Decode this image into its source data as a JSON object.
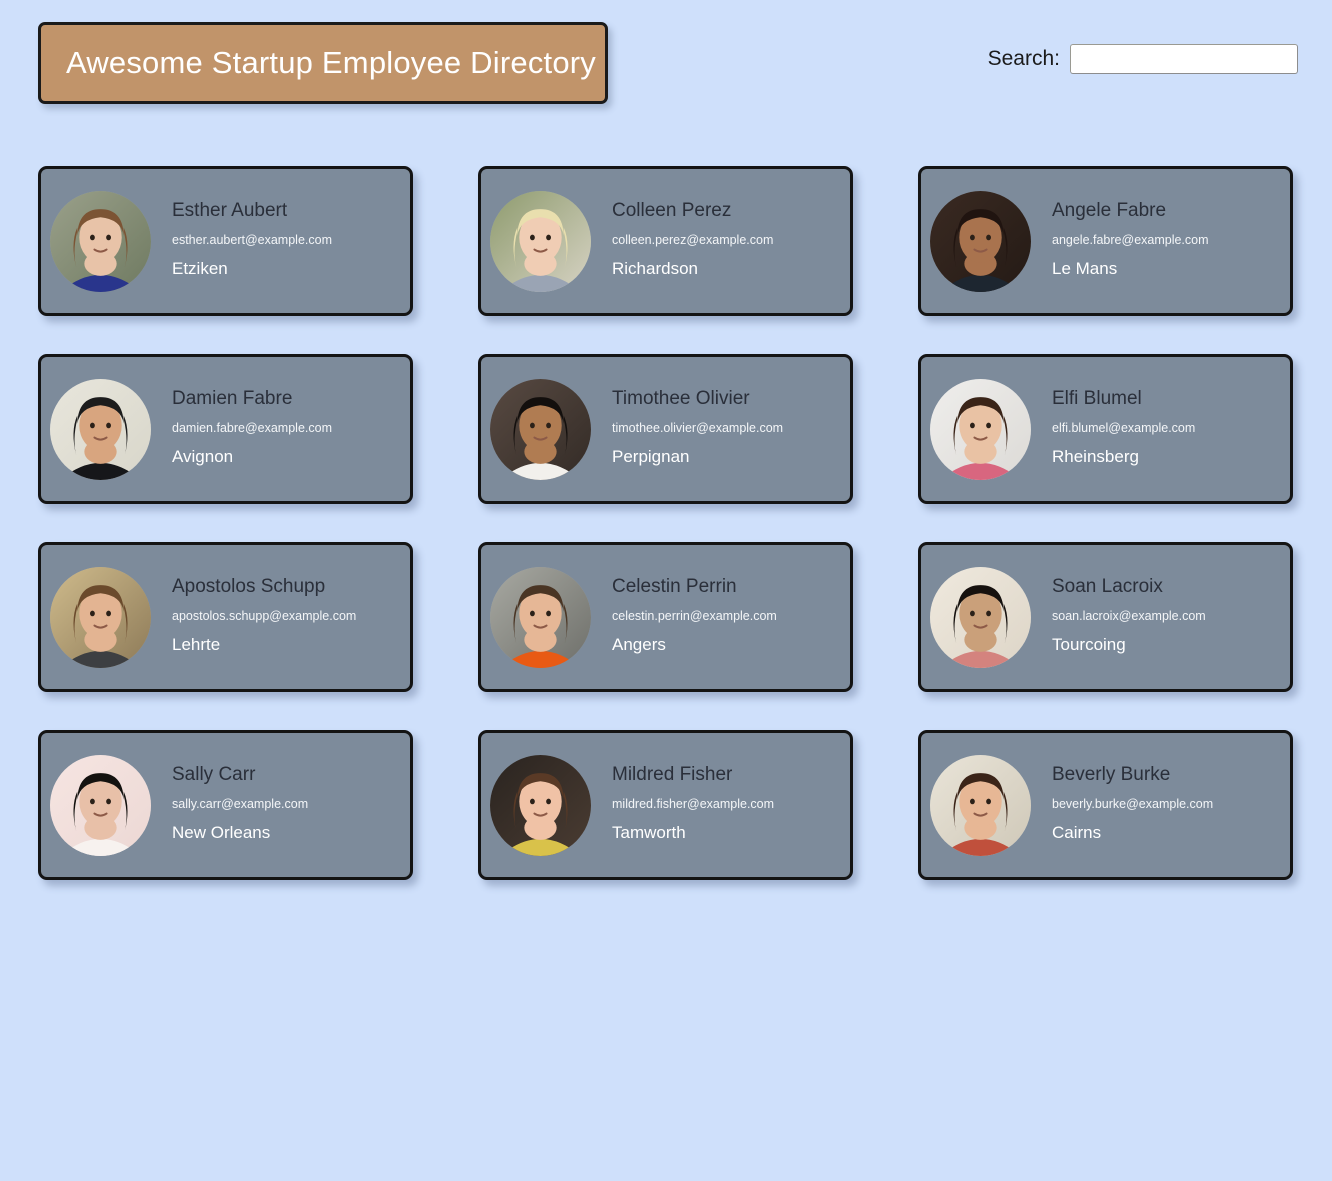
{
  "header": {
    "title": "Awesome Startup Employee Directory",
    "banner_color": "#c1946a",
    "search": {
      "label": "Search:",
      "value": "",
      "placeholder": ""
    }
  },
  "theme": {
    "page_background": "#cfe0fb",
    "card_background": "#7d8b9b",
    "card_border": "#141414",
    "name_color": "#2a2f3a",
    "text_color": "#ffffff"
  },
  "employees": [
    {
      "name": "Esther Aubert",
      "email": "esther.aubert@example.com",
      "city": "Etziken",
      "avatar": {
        "skin": "#e8c3a8",
        "hair": "#7c5434",
        "bg1": "#9aa08a",
        "bg2": "#6f7a61",
        "clothes": "#29358c"
      }
    },
    {
      "name": "Colleen Perez",
      "email": "colleen.perez@example.com",
      "city": "Richardson",
      "avatar": {
        "skin": "#f0cdb4",
        "hair": "#e9dfae",
        "bg1": "#8e9b6e",
        "bg2": "#d7d3c4",
        "clothes": "#9aa4b4"
      }
    },
    {
      "name": "Angele Fabre",
      "email": "angele.fabre@example.com",
      "city": "Le Mans",
      "avatar": {
        "skin": "#a9734e",
        "hair": "#201410",
        "bg1": "#3a2a22",
        "bg2": "#241a15",
        "clothes": "#1d2630"
      }
    },
    {
      "name": "Damien Fabre",
      "email": "damien.fabre@example.com",
      "city": "Avignon",
      "avatar": {
        "skin": "#d8a57f",
        "hair": "#1c1c1c",
        "bg1": "#e8e6dc",
        "bg2": "#d8d6ca",
        "clothes": "#16171a"
      }
    },
    {
      "name": "Timothee Olivier",
      "email": "timothee.olivier@example.com",
      "city": "Perpignan",
      "avatar": {
        "skin": "#b07c52",
        "hair": "#130f0d",
        "bg1": "#584a42",
        "bg2": "#332b26",
        "clothes": "#f2f0ec"
      }
    },
    {
      "name": "Elfi Blumel",
      "email": "elfi.blumel@example.com",
      "city": "Rheinsberg",
      "avatar": {
        "skin": "#e9c2a4",
        "hair": "#3a2418",
        "bg1": "#efeeec",
        "bg2": "#dcdad6",
        "clothes": "#d8667f"
      }
    },
    {
      "name": "Apostolos Schupp",
      "email": "apostolos.schupp@example.com",
      "city": "Lehrte",
      "avatar": {
        "skin": "#e3b492",
        "hair": "#6b4a2c",
        "bg1": "#cfbb8c",
        "bg2": "#8d7a58",
        "clothes": "#3d3f42"
      }
    },
    {
      "name": "Celestin Perrin",
      "email": "celestin.perrin@example.com",
      "city": "Angers",
      "avatar": {
        "skin": "#e6b796",
        "hair": "#4a3524",
        "bg1": "#a8a9a2",
        "bg2": "#6e6f6a",
        "clothes": "#e85a14"
      }
    },
    {
      "name": "Soan Lacroix",
      "email": "soan.lacroix@example.com",
      "city": "Tourcoing",
      "avatar": {
        "skin": "#caa07a",
        "hair": "#16110e",
        "bg1": "#efe9de",
        "bg2": "#ddd5c7",
        "clothes": "#d4837e"
      }
    },
    {
      "name": "Sally Carr",
      "email": "sally.carr@example.com",
      "city": "New Orleans",
      "avatar": {
        "skin": "#e8c0a8",
        "hair": "#14120f",
        "bg1": "#f6e5e2",
        "bg2": "#ecd8d4",
        "clothes": "#f7f2ef"
      }
    },
    {
      "name": "Mildred Fisher",
      "email": "mildred.fisher@example.com",
      "city": "Tamworth",
      "avatar": {
        "skin": "#f0c2a6",
        "hair": "#5a3a26",
        "bg1": "#2a2420",
        "bg2": "#4a3c32",
        "clothes": "#d9c24a"
      }
    },
    {
      "name": "Beverly Burke",
      "email": "beverly.burke@example.com",
      "city": "Cairns",
      "avatar": {
        "skin": "#e7b795",
        "hair": "#3b2418",
        "bg1": "#e9e4d8",
        "bg2": "#cfc8b8",
        "clothes": "#c0503c"
      }
    }
  ]
}
